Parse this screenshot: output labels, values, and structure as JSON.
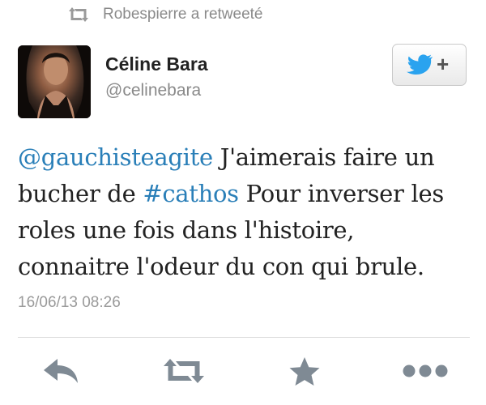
{
  "retweet_notice": {
    "text": "Robespierre a retweeté",
    "icon": "retweet-icon"
  },
  "author": {
    "name": "Céline Bara",
    "handle": "@celinebara"
  },
  "follow_button": {
    "icon": "twitter-bird-follow-icon",
    "symbol": "+",
    "accent": "#2aa3ef"
  },
  "tweet": {
    "mention": "@gauchisteagite",
    "text_1": " J'aimerais faire un bucher de ",
    "hashtag": "#cathos",
    "text_2": " Pour inverser les roles une fois dans l'histoire, connaitre l'odeur du con qui brule.",
    "link_color": "#2a7fb8"
  },
  "timestamp": "16/06/13 08:26",
  "actions": [
    {
      "name": "reply",
      "icon": "reply-icon"
    },
    {
      "name": "retweet",
      "icon": "retweet-icon"
    },
    {
      "name": "favorite",
      "icon": "star-icon"
    },
    {
      "name": "more",
      "icon": "more-icon"
    }
  ]
}
